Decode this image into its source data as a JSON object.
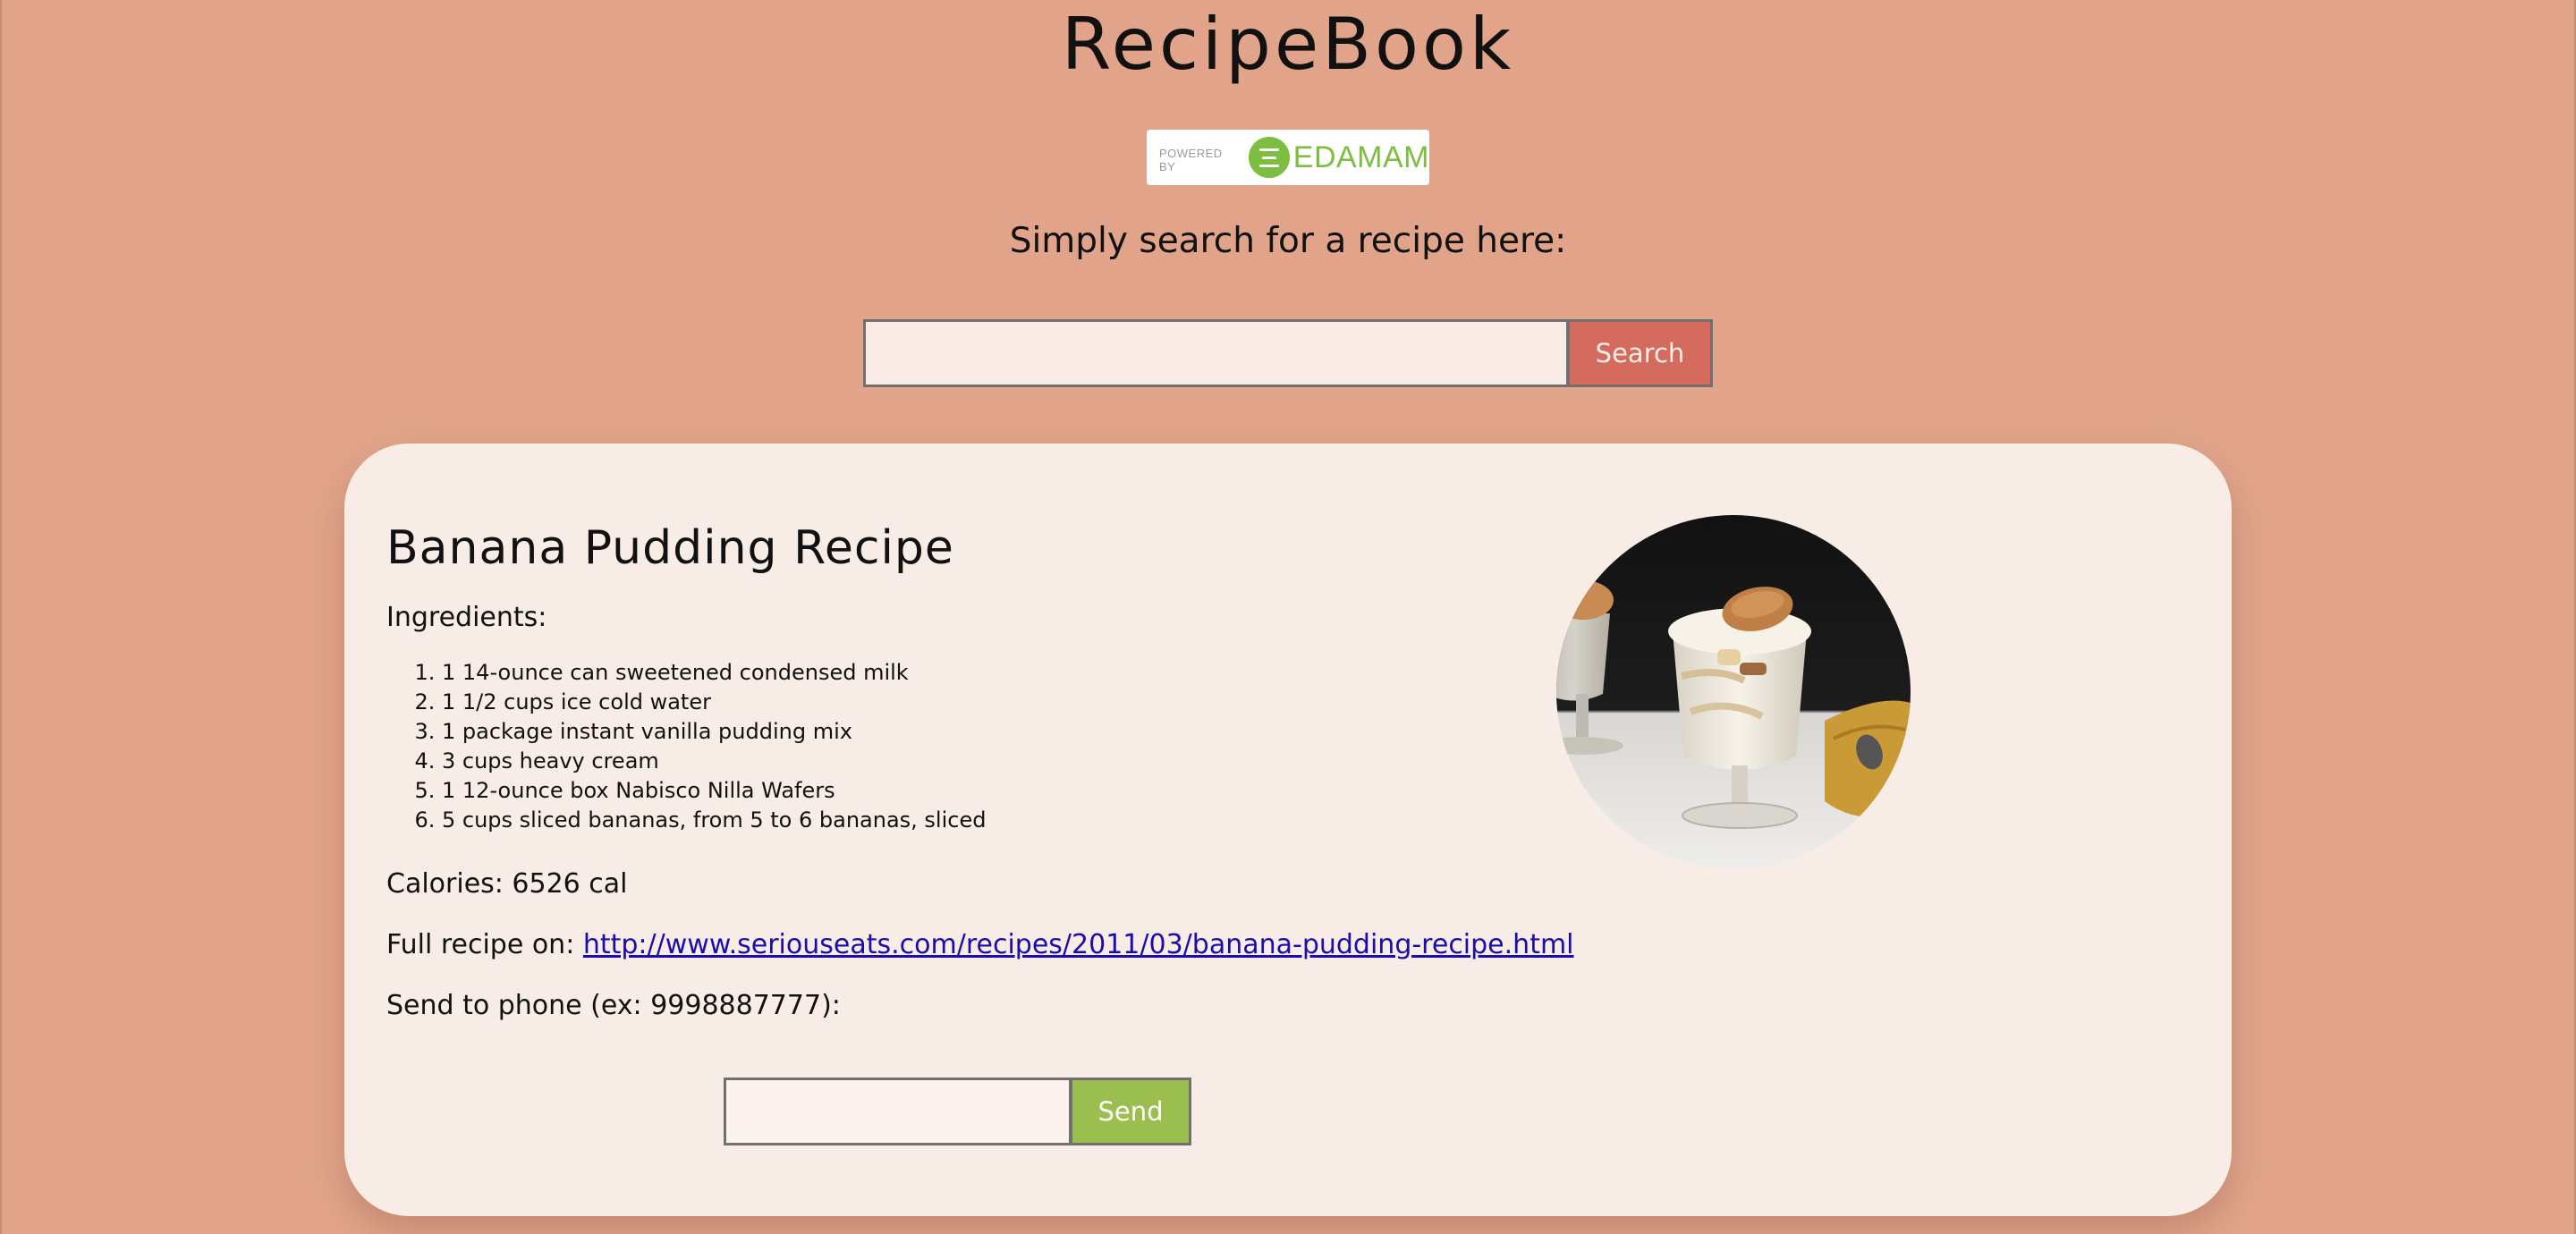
{
  "app": {
    "title": "RecipeBook"
  },
  "attribution": {
    "powered_by": "POWERED BY",
    "brand": "EDAMAM",
    "brand_color": "#7dbd3f",
    "icon": "edamam-logo-icon"
  },
  "search": {
    "prompt": "Simply search for a recipe here:",
    "value": "",
    "placeholder": "",
    "button_label": "Search"
  },
  "recipe": {
    "title": "Banana Pudding Recipe",
    "ingredients_heading": "Ingredients:",
    "ingredients": [
      "1 14-ounce can sweetened condensed milk",
      "1 1/2 cups ice cold water",
      "1 package instant vanilla pudding mix",
      "3 cups heavy cream",
      "1 12-ounce box Nabisco Nilla Wafers",
      "5 cups sliced bananas, from 5 to 6 bananas, sliced"
    ],
    "calories": "Calories: 6526 cal",
    "full_recipe_label": "Full recipe on: ",
    "full_recipe_url": "http://www.seriouseats.com/recipes/2011/03/banana-pudding-recipe.html",
    "send_label": "Send to phone (ex: 9998887777):",
    "phone_value": "",
    "send_button_label": "Send"
  },
  "colors": {
    "page_background": "#e1a48a",
    "card_background": "#f8ece6",
    "search_button": "#d56a5e",
    "send_button": "#9bbf4e",
    "link": "#1a0dab"
  }
}
